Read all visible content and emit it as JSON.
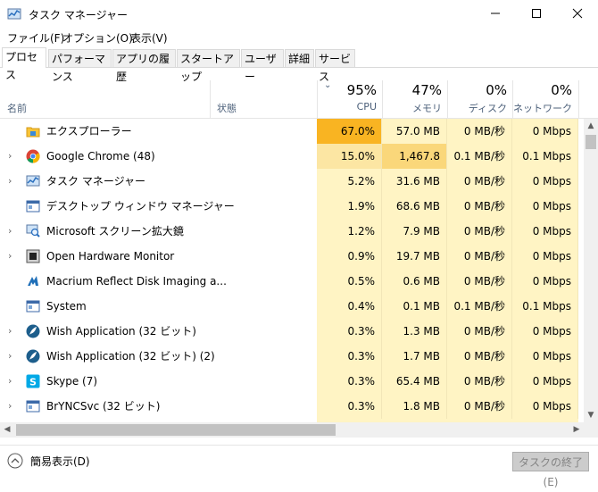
{
  "window": {
    "title": "タスク マネージャー",
    "minimize": "—",
    "maximize": "☐",
    "close": "✕"
  },
  "menu": [
    "ファイル(F)",
    "オプション(O)",
    "表示(V)"
  ],
  "tabs": [
    "プロセス",
    "パフォーマンス",
    "アプリの履歴",
    "スタートアップ",
    "ユーザー",
    "詳細",
    "サービス"
  ],
  "columns": {
    "name": "名前",
    "status": "状態",
    "cpu": {
      "pct": "95%",
      "label": "CPU"
    },
    "memory": {
      "pct": "47%",
      "label": "メモリ"
    },
    "disk": {
      "pct": "0%",
      "label": "ディスク"
    },
    "network": {
      "pct": "0%",
      "label": "ネットワーク"
    }
  },
  "processes": [
    {
      "name": "エクスプローラー",
      "cpu": "67.0%",
      "mem": "57.0 MB",
      "disk": "0 MB/秒",
      "net": "0 Mbps",
      "icon": "folder-icon",
      "expand": false
    },
    {
      "name": "Google Chrome (48)",
      "cpu": "15.0%",
      "mem": "1,467.8 MB",
      "disk": "0.1 MB/秒",
      "net": "0.1 Mbps",
      "icon": "chrome-icon",
      "expand": true
    },
    {
      "name": "タスク マネージャー",
      "cpu": "5.2%",
      "mem": "31.6 MB",
      "disk": "0 MB/秒",
      "net": "0 Mbps",
      "icon": "task-manager-icon",
      "expand": true
    },
    {
      "name": "デスクトップ ウィンドウ マネージャー",
      "cpu": "1.9%",
      "mem": "68.6 MB",
      "disk": "0 MB/秒",
      "net": "0 Mbps",
      "icon": "window-icon",
      "expand": false
    },
    {
      "name": "Microsoft スクリーン拡大鏡",
      "cpu": "1.2%",
      "mem": "7.9 MB",
      "disk": "0 MB/秒",
      "net": "0 Mbps",
      "icon": "magnifier-icon",
      "expand": true
    },
    {
      "name": "Open Hardware Monitor",
      "cpu": "0.9%",
      "mem": "19.7 MB",
      "disk": "0 MB/秒",
      "net": "0 Mbps",
      "icon": "chip-icon",
      "expand": true
    },
    {
      "name": "Macrium Reflect Disk Imaging a...",
      "cpu": "0.5%",
      "mem": "0.6 MB",
      "disk": "0 MB/秒",
      "net": "0 Mbps",
      "icon": "macrium-icon",
      "expand": false
    },
    {
      "name": "System",
      "cpu": "0.4%",
      "mem": "0.1 MB",
      "disk": "0.1 MB/秒",
      "net": "0.1 Mbps",
      "icon": "window-icon",
      "expand": false
    },
    {
      "name": "Wish Application (32 ビット)",
      "cpu": "0.3%",
      "mem": "1.3 MB",
      "disk": "0 MB/秒",
      "net": "0 Mbps",
      "icon": "feather-icon",
      "expand": true
    },
    {
      "name": "Wish Application (32 ビット) (2)",
      "cpu": "0.3%",
      "mem": "1.7 MB",
      "disk": "0 MB/秒",
      "net": "0 Mbps",
      "icon": "feather-icon",
      "expand": true
    },
    {
      "name": "Skype (7)",
      "cpu": "0.3%",
      "mem": "65.4 MB",
      "disk": "0 MB/秒",
      "net": "0 Mbps",
      "icon": "skype-icon",
      "expand": true
    },
    {
      "name": "BrYNCSvc (32 ビット)",
      "cpu": "0.3%",
      "mem": "1.8 MB",
      "disk": "0 MB/秒",
      "net": "0 Mbps",
      "icon": "window-icon",
      "expand": true
    }
  ],
  "footer": {
    "fewer_details": "簡易表示(D)",
    "end_task": "タスクの終了(E)"
  },
  "colors": {
    "cpu_high": "#f9b422",
    "cpu_mid": "#fce6a3",
    "mem_mid": "#fad77a",
    "base": "#fff4c4",
    "light": "#fff9db"
  }
}
